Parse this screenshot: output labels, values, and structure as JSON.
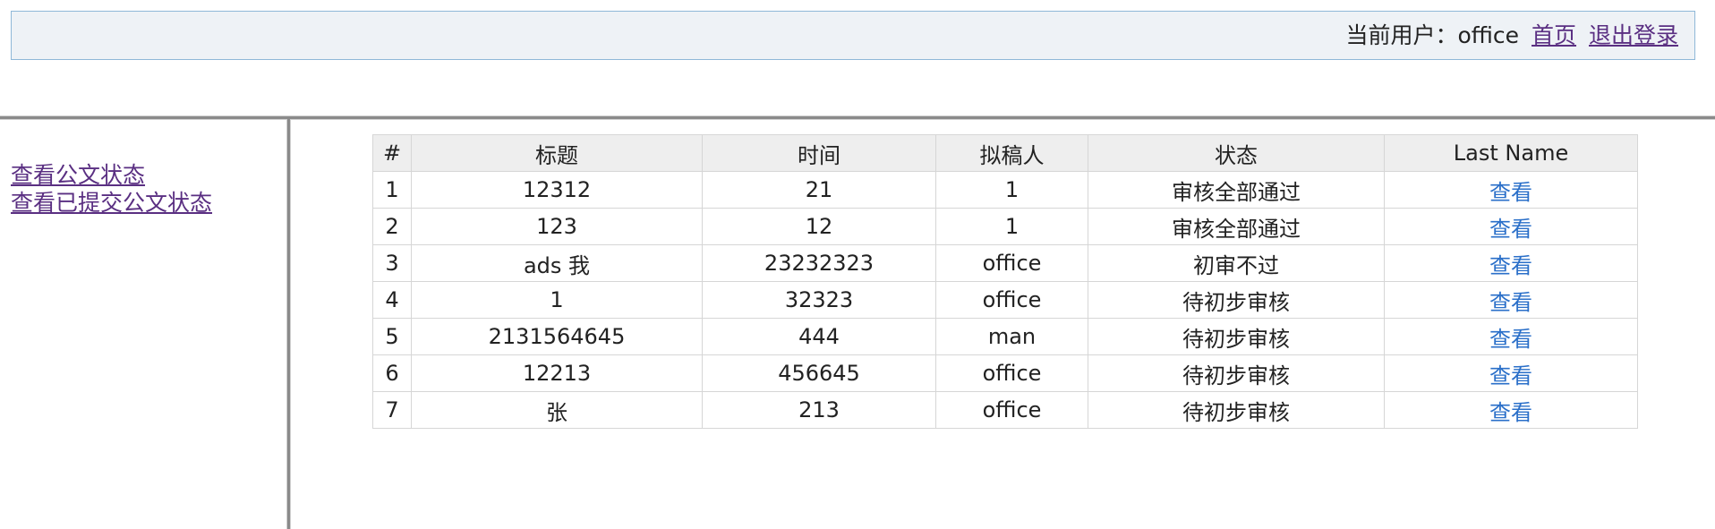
{
  "header": {
    "user_label": "当前用户：office",
    "home_link": "首页",
    "logout_link": "退出登录"
  },
  "sidebar": {
    "items": [
      {
        "label": "查看公文状态"
      },
      {
        "label": "查看已提交公文状态"
      }
    ]
  },
  "table": {
    "columns": [
      "#",
      "标题",
      "时间",
      "拟稿人",
      "状态",
      "Last Name"
    ],
    "rows": [
      {
        "num": "1",
        "title": "12312",
        "time": "21",
        "author": "1",
        "status": "审核全部通过",
        "action": "查看"
      },
      {
        "num": "2",
        "title": "123",
        "time": "12",
        "author": "1",
        "status": "审核全部通过",
        "action": "查看"
      },
      {
        "num": "3",
        "title": "ads 我",
        "time": "23232323",
        "author": "office",
        "status": "初审不过",
        "action": "查看"
      },
      {
        "num": "4",
        "title": "1",
        "time": "32323",
        "author": "office",
        "status": "待初步审核",
        "action": "查看"
      },
      {
        "num": "5",
        "title": "2131564645",
        "time": "444",
        "author": "man",
        "status": "待初步审核",
        "action": "查看"
      },
      {
        "num": "6",
        "title": "12213",
        "time": "456645",
        "author": "office",
        "status": "待初步审核",
        "action": "查看"
      },
      {
        "num": "7",
        "title": "张",
        "time": "213",
        "author": "office",
        "status": "待初步审核",
        "action": "查看"
      }
    ]
  },
  "colors": {
    "link_visited": "#5a2f82",
    "link_action": "#2a6fc9",
    "header_bg": "#eef2f6",
    "header_border": "#8fb8d8"
  }
}
